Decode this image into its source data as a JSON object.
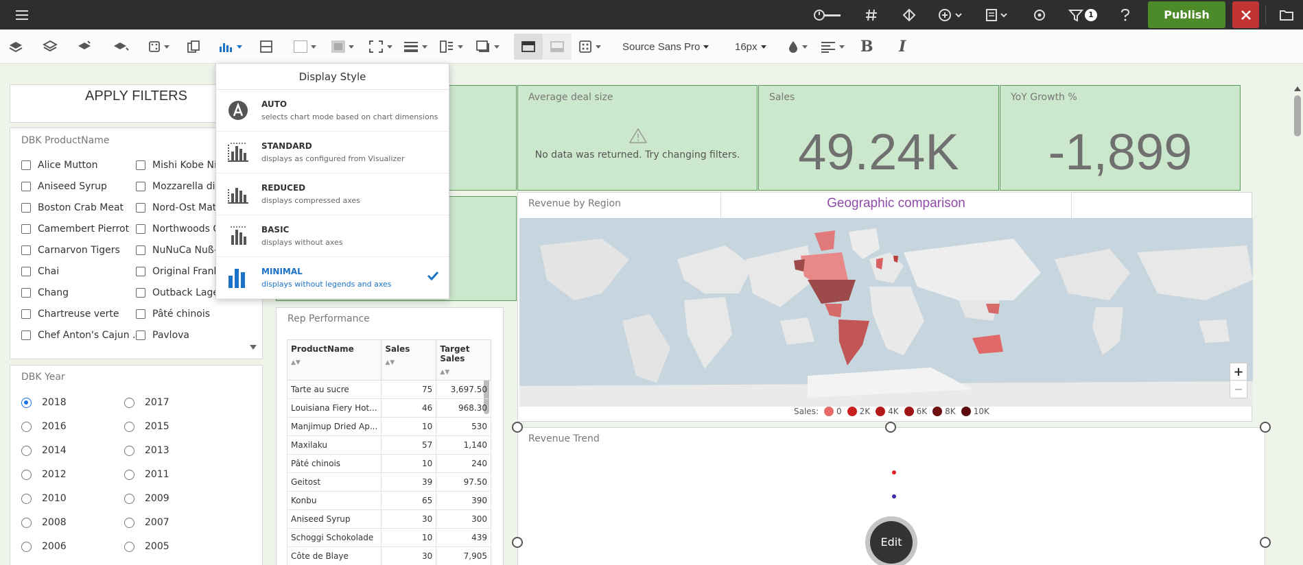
{
  "topbar": {
    "filter_count": "1",
    "publish_label": "Publish"
  },
  "toolbar": {
    "font_family": "Source Sans Pro",
    "font_size": "16px"
  },
  "apply_filters_label": "APPLY FILTERS",
  "product_filter": {
    "title": "DBK ProductName",
    "col1": [
      "Alice Mutton",
      "Aniseed Syrup",
      "Boston Crab Meat",
      "Camembert Pierrot",
      "Carnarvon Tigers",
      "Chai",
      "Chang",
      "Chartreuse verte",
      "Chef Anton's Cajun ..."
    ],
    "col2": [
      "Mishi Kobe Niku",
      "Mozzarella di Giovanni",
      "Nord-Ost Matjeshering",
      "Northwoods Cranberry Sauce",
      "NuNuCa Nuß-Nougat-Creme",
      "Original Frankfurter grüne Soße",
      "Outback Lager",
      "Pâté chinois",
      "Pavlova"
    ]
  },
  "year_filter": {
    "title": "DBK Year",
    "selected": "2018",
    "col1": [
      "2018",
      "2016",
      "2014",
      "2012",
      "2010",
      "2008",
      "2006"
    ],
    "col2": [
      "2017",
      "2015",
      "2013",
      "2011",
      "2009",
      "2007",
      "2005"
    ]
  },
  "kpis": {
    "avg_deal": {
      "title": "Average deal size",
      "message": "No data was returned. Try changing filters."
    },
    "sales": {
      "title": "Sales",
      "value": "49.24K"
    },
    "yoy": {
      "title": "YoY Growth %",
      "value": "-1,899"
    }
  },
  "map": {
    "title": "Revenue by Region",
    "subtitle": "Geographic comparison",
    "legend_label": "Sales:",
    "legend": [
      {
        "label": "0",
        "color": "#e86a6a"
      },
      {
        "label": "2K",
        "color": "#c91f1f"
      },
      {
        "label": "4K",
        "color": "#b51a1a"
      },
      {
        "label": "6K",
        "color": "#a01515"
      },
      {
        "label": "8K",
        "color": "#6e0f0f"
      },
      {
        "label": "10K",
        "color": "#5a0c0c"
      }
    ],
    "zoom_in": "+",
    "zoom_out": "−"
  },
  "rep_performance": {
    "title": "Rep Performance",
    "columns": [
      "ProductName",
      "Sales",
      "Target Sales"
    ],
    "rows": [
      [
        "Tarte au sucre",
        "75",
        "3,697.50"
      ],
      [
        "Louisiana Fiery Hot...",
        "46",
        "968.30"
      ],
      [
        "Manjimup Dried Ap...",
        "10",
        "530"
      ],
      [
        "Maxilaku",
        "57",
        "1,140"
      ],
      [
        "Pâté chinois",
        "10",
        "240"
      ],
      [
        "Geitost",
        "39",
        "97.50"
      ],
      [
        "Konbu",
        "65",
        "390"
      ],
      [
        "Aniseed Syrup",
        "30",
        "300"
      ],
      [
        "Schoggi Schokolade",
        "10",
        "439"
      ],
      [
        "Côte de Blaye",
        "30",
        "7,905"
      ]
    ]
  },
  "revenue_trend": {
    "title": "Revenue Trend",
    "edit_label": "Edit"
  },
  "display_style": {
    "header": "Display Style",
    "options": [
      {
        "title": "AUTO",
        "desc": "selects chart mode based on chart dimensions"
      },
      {
        "title": "STANDARD",
        "desc": "displays as configured from Visualizer"
      },
      {
        "title": "REDUCED",
        "desc": "displays compressed axes"
      },
      {
        "title": "BASIC",
        "desc": "displays without axes"
      },
      {
        "title": "MINIMAL",
        "desc": "displays without legends and axes"
      }
    ],
    "selected": "MINIMAL"
  }
}
